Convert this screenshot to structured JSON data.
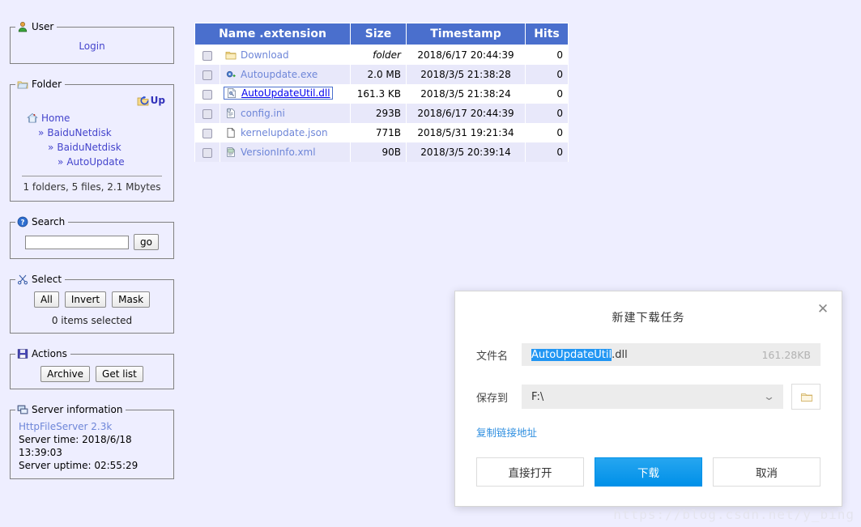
{
  "page": {
    "background": "#eeeeff",
    "watermark": "https://blog.csdn.net/y_bing"
  },
  "sidebar": {
    "user": {
      "legend": "User",
      "icon": "user-icon",
      "login_label": "Login"
    },
    "folder": {
      "legend": "Folder",
      "icon": "folder-open-icon",
      "up_label": "Up",
      "up_icon": "folder-up-icon",
      "tree": [
        {
          "label": "Home",
          "level": 0,
          "icon": "home-icon",
          "bullet": ""
        },
        {
          "label": "BaiduNetdisk",
          "level": 1,
          "icon": "",
          "bullet": "»"
        },
        {
          "label": "BaiduNetdisk",
          "level": 2,
          "icon": "",
          "bullet": "»"
        },
        {
          "label": "AutoUpdate",
          "level": 3,
          "icon": "",
          "bullet": "»"
        }
      ],
      "stats": "1 folders, 5 files, 2.1 Mbytes"
    },
    "search": {
      "legend": "Search",
      "icon": "help-icon",
      "value": "",
      "placeholder": "",
      "go_label": "go"
    },
    "select": {
      "legend": "Select",
      "icon": "scissors-icon",
      "buttons": [
        "All",
        "Invert",
        "Mask"
      ],
      "count_text": "0 items selected"
    },
    "actions": {
      "legend": "Actions",
      "icon": "save-icon",
      "buttons": [
        "Archive",
        "Get list"
      ]
    },
    "server": {
      "legend": "Server information",
      "icon": "server-icon",
      "name": "HttpFileServer 2.3k",
      "time": "Server time: 2018/6/18 13:39:03",
      "uptime": "Server uptime: 02:55:29"
    }
  },
  "table": {
    "accent": "#4a6fcd",
    "headers": [
      "Name .extension",
      "Size",
      "Timestamp",
      "Hits"
    ],
    "rows": [
      {
        "name": "Download",
        "icon": "folder-icon",
        "size": "folder",
        "size_italic": true,
        "timestamp": "2018/6/17 20:44:39",
        "hits": "0",
        "focused": false
      },
      {
        "name": "Autoupdate.exe",
        "icon": "exe-icon",
        "size": "2.0 MB",
        "size_italic": false,
        "timestamp": "2018/3/5 21:38:28",
        "hits": "0",
        "focused": false
      },
      {
        "name": "AutoUpdateUtil.dll",
        "icon": "dll-icon",
        "size": "161.3 KB",
        "size_italic": false,
        "timestamp": "2018/3/5 21:38:24",
        "hits": "0",
        "focused": true
      },
      {
        "name": "config.ini",
        "icon": "ini-icon",
        "size": "293B",
        "size_italic": false,
        "timestamp": "2018/6/17 20:44:39",
        "hits": "0",
        "focused": false
      },
      {
        "name": "kernelupdate.json",
        "icon": "blank-file-icon",
        "size": "771B",
        "size_italic": false,
        "timestamp": "2018/5/31 19:21:34",
        "hits": "0",
        "focused": false
      },
      {
        "name": "VersionInfo.xml",
        "icon": "xml-icon",
        "size": "90B",
        "size_italic": false,
        "timestamp": "2018/3/5 20:39:14",
        "hits": "0",
        "focused": false
      }
    ]
  },
  "dialog": {
    "title": "新建下载任务",
    "close_icon": "close-icon",
    "filename_label": "文件名",
    "filename_selected": "AutoUpdateUtil",
    "filename_rest": ".dll",
    "filesize": "161.28KB",
    "saveto_label": "保存到",
    "saveto_value": "F:\\",
    "saveto_chevron": "chevron-down-icon",
    "browse_icon": "folder-icon",
    "copy_link_label": "复制链接地址",
    "buttons": {
      "open": "直接打开",
      "download": "下载",
      "cancel": "取消"
    },
    "primary_color": "#0090e8"
  }
}
